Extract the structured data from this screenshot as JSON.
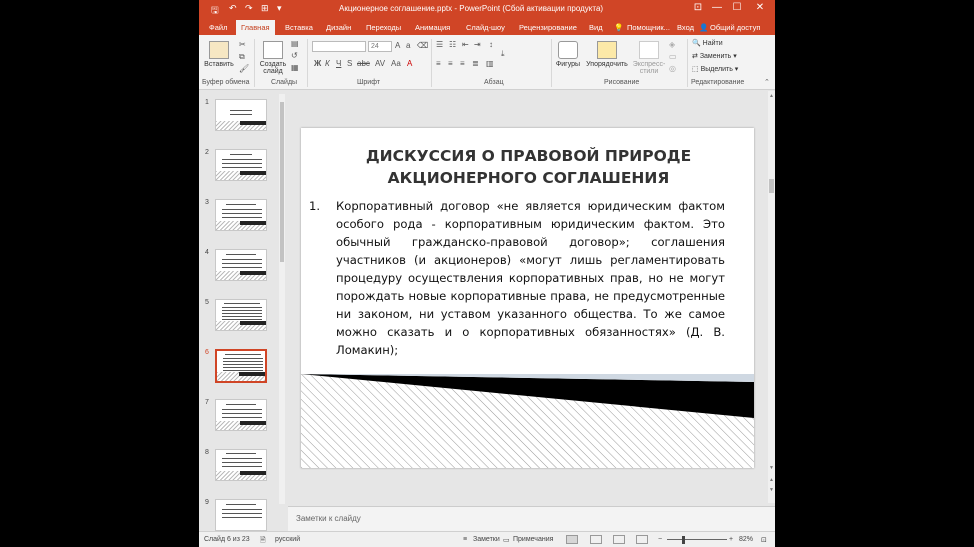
{
  "window": {
    "title": "Акционерное соглашение.pptx - PowerPoint (Сбой активации продукта)",
    "minimize": "—",
    "maximize": "☐",
    "close": "✕",
    "restore_ribbon": "⊡"
  },
  "quick_access": {
    "save": "🖫",
    "undo": "↶",
    "redo": "↷",
    "start": "⊞",
    "more": "▾"
  },
  "tabs": [
    {
      "label": "Файл"
    },
    {
      "label": "Главная"
    },
    {
      "label": "Вставка"
    },
    {
      "label": "Дизайн"
    },
    {
      "label": "Переходы"
    },
    {
      "label": "Анимация"
    },
    {
      "label": "Слайд-шоу"
    },
    {
      "label": "Рецензирование"
    },
    {
      "label": "Вид"
    }
  ],
  "tellme": "Помощник...",
  "signin": "Вход",
  "share": "Общий доступ",
  "ribbon": {
    "paste": "Вставить",
    "create_slide": "Создать слайд",
    "shapes": "Фигуры",
    "arrange": "Упорядочить",
    "quick_styles": "Экспресс-стили",
    "find": "Найти",
    "replace": "Заменить",
    "select": "Выделить",
    "font_size": "24",
    "groups": {
      "clipboard": "Буфер обмена",
      "slides": "Слайды",
      "font": "Шрифт",
      "paragraph": "Абзац",
      "drawing": "Рисование",
      "editing": "Редактирование"
    }
  },
  "thumbnails": [
    {
      "num": "1"
    },
    {
      "num": "2"
    },
    {
      "num": "3"
    },
    {
      "num": "4"
    },
    {
      "num": "5"
    },
    {
      "num": "6"
    },
    {
      "num": "7"
    },
    {
      "num": "8"
    },
    {
      "num": "9"
    }
  ],
  "slide": {
    "title_line1": "ДИСКУССИЯ О ПРАВОВОЙ ПРИРОДЕ",
    "title_line2": "АКЦИОНЕРНОГО СОГЛАШЕНИЯ",
    "item_number": "1.",
    "item_text": "Корпоративный договор «не является юридическим фактом особого рода - корпоративным юридическим фактом. Это обычный гражданско-правовой договор»; соглашения участников (и акционеров) «могут лишь регламентировать процедуру осуществления корпоративных прав, но не могут порождать новые корпоративные права, не предусмотренные ни законом, ни уставом указанного общества. То же самое можно сказать и о корпоративных обязанностях» (Д. В. Ломакин);"
  },
  "notes_placeholder": "Заметки к слайду",
  "status": {
    "slide_counter": "Слайд 6 из 23",
    "language": "русский",
    "notes_btn": "Заметки",
    "comments_btn": "Примечания",
    "zoom_minus": "−",
    "zoom_plus": "+",
    "zoom": "82%"
  },
  "colors": {
    "accent": "#d04526",
    "slide_dark_band": "#000000"
  }
}
